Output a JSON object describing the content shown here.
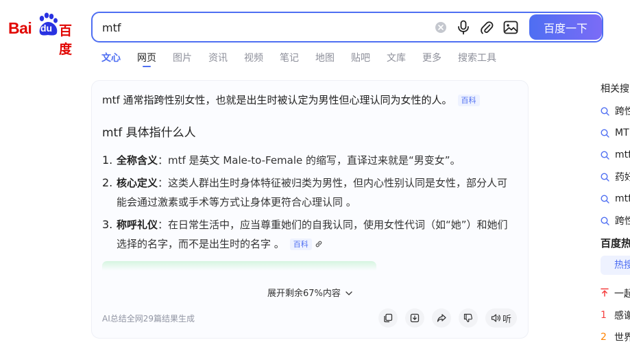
{
  "logo": {
    "text_left": "Bai",
    "text_paw": "du",
    "text_cn": "百度"
  },
  "search": {
    "query": "mtf",
    "button": "百度一下"
  },
  "tabs": [
    "文心",
    "网页",
    "图片",
    "资讯",
    "视频",
    "笔记",
    "地图",
    "贴吧",
    "文库",
    "更多",
    "搜索工具"
  ],
  "ai": {
    "summary": "mtf 通常指跨性别女性，也就是出生时被认定为男性但心理认同为女性的人。",
    "summary_tag": "百科",
    "section_title": "mtf 具体指什么人",
    "items": [
      {
        "num": "1.",
        "term": "全称含义",
        "text": "：mtf 是英文 Male-to-Female 的缩写，直译过来就是“男变女”。"
      },
      {
        "num": "2.",
        "term": "核心定义",
        "text": "：这类人群出生时身体特征被归类为男性，但内心性别认同是女性，部分人可能会通过激素或手术等方式让身体更符合心理认同 。"
      },
      {
        "num": "3.",
        "term": "称呼礼仪",
        "text": "：在日常生活中，应当尊重她们的自我认同，使用女性代词（如“她”）和她们选择的名字，而不是出生时的名字 。",
        "tag": "百科"
      }
    ],
    "expand": "展开剩余67%内容",
    "footer": "AI总结全网29篇结果生成",
    "listen": "听"
  },
  "sidebar": {
    "related_title": "相关搜",
    "related": [
      "跨性",
      "MT",
      "mtf",
      "药好",
      "mtf",
      "跨性"
    ],
    "hot_title": "百度热",
    "hot_tab": "热搜",
    "hot": [
      {
        "rank": "",
        "text": "一起"
      },
      {
        "rank": "1",
        "text": "感谢"
      },
      {
        "rank": "2",
        "text": "世界"
      }
    ]
  },
  "colors": {
    "accent": "#4e6ef2",
    "brand_red": "#e10602"
  }
}
